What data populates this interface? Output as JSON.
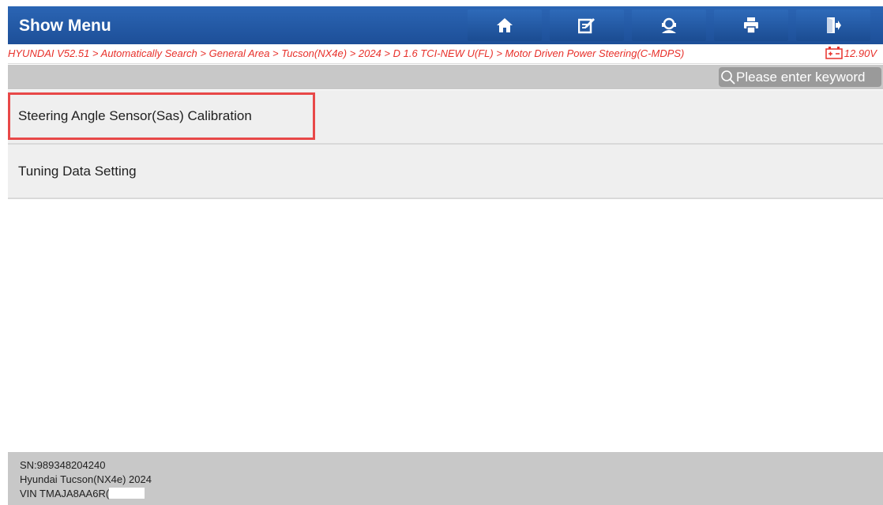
{
  "header": {
    "title": "Show Menu",
    "buttons": [
      {
        "name": "home-button",
        "icon": "home-icon"
      },
      {
        "name": "edit-button",
        "icon": "edit-icon"
      },
      {
        "name": "support-button",
        "icon": "support-agent-icon"
      },
      {
        "name": "print-button",
        "icon": "printer-icon"
      },
      {
        "name": "exit-button",
        "icon": "exit-icon"
      }
    ]
  },
  "breadcrumb": {
    "path": "HYUNDAI V52.51 > Automatically Search > General Area > Tucson(NX4e) > 2024 > D 1.6 TCI-NEW U(FL) > Motor Driven Power Steering(C-MDPS)",
    "voltage": "12.90V"
  },
  "search": {
    "placeholder": "Please enter keyword"
  },
  "menu": {
    "items": [
      {
        "label": "Steering Angle Sensor(Sas) Calibration",
        "highlighted": true
      },
      {
        "label": "Tuning Data Setting",
        "highlighted": false
      }
    ]
  },
  "footer": {
    "sn": "SN:989348204240",
    "vehicle": "Hyundai Tucson(NX4e) 2024",
    "vin": "VIN TMAJA8AA6R("
  },
  "colors": {
    "header_blue": "#2b65b4",
    "crumb_red": "#e8302a",
    "highlight_red": "#e84848",
    "panel_gray": "#c8c8c8"
  }
}
